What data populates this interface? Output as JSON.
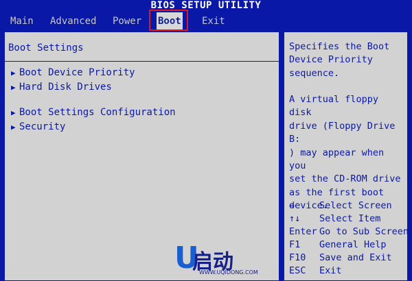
{
  "window": {
    "title": "BIOS SETUP UTILITY"
  },
  "tabs": [
    {
      "label": "Main"
    },
    {
      "label": "Advanced"
    },
    {
      "label": "Power"
    },
    {
      "label": "Boot"
    },
    {
      "label": "Exit"
    }
  ],
  "active_tab": "Boot",
  "main": {
    "section_title": "Boot Settings",
    "items": [
      {
        "label": "Boot Device Priority"
      },
      {
        "label": "Hard Disk Drives"
      },
      {
        "label": "Boot Settings Configuration"
      },
      {
        "label": "Security"
      }
    ]
  },
  "help": {
    "line1": "Specifies the Boot",
    "line2": "Device Priority",
    "line3": "sequence.",
    "line4": "A virtual floppy disk",
    "line5": "drive (Floppy Drive B:",
    "line6": ") may appear when you",
    "line7": "set the CD-ROM drive",
    "line8": "as the first boot",
    "line9": "device."
  },
  "keys": [
    {
      "key": "↔",
      "action": "Select Screen"
    },
    {
      "key": "↑↓",
      "action": "Select Item"
    },
    {
      "key": "Enter",
      "action": "Go to Sub Screen"
    },
    {
      "key": "F1",
      "action": "General Help"
    },
    {
      "key": "F10",
      "action": "Save and Exit"
    },
    {
      "key": "ESC",
      "action": "Exit"
    }
  ],
  "watermark": {
    "letter": "U",
    "text": "启动",
    "url": "WWW.UQIDONG.COM"
  },
  "colors": {
    "background": "#0a18a8",
    "panel": "#d2d2d2",
    "text": "#0a18a8",
    "highlight": "#e01818"
  }
}
